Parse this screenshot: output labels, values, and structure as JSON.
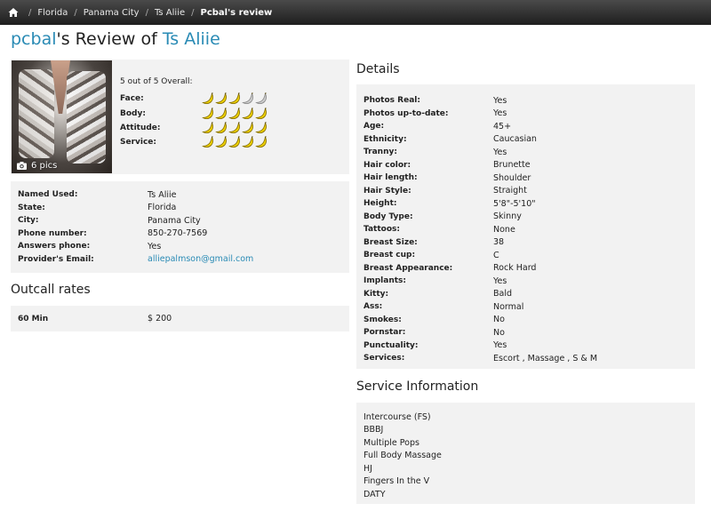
{
  "breadcrumb": {
    "items": [
      {
        "label": "Florida"
      },
      {
        "label": "Panama City"
      },
      {
        "label": "Ts Aliie"
      },
      {
        "label": "Pcbal's review"
      }
    ]
  },
  "title": {
    "user": "pcbal",
    "middle": "'s Review of ",
    "provider": "Ts Aliie"
  },
  "summary": {
    "pics_label": "6 pics",
    "overall": "5 out of 5 Overall:",
    "ratings": [
      {
        "label": "Face:",
        "score": 3,
        "max": 5
      },
      {
        "label": "Body:",
        "score": 5,
        "max": 5
      },
      {
        "label": "Attitude:",
        "score": 5,
        "max": 5
      },
      {
        "label": "Service:",
        "score": 5,
        "max": 5
      }
    ]
  },
  "info": {
    "rows": [
      {
        "k": "Named Used:",
        "v": "Ts Aliie"
      },
      {
        "k": "State:",
        "v": "Florida"
      },
      {
        "k": "City:",
        "v": "Panama City"
      },
      {
        "k": "Phone number:",
        "v": "850-270-7569"
      },
      {
        "k": "Answers phone:",
        "v": "Yes"
      },
      {
        "k": "Provider's Email:",
        "v": "alliepalmson@gmail.com"
      }
    ]
  },
  "outcall": {
    "title": "Outcall rates",
    "rows": [
      {
        "k": "60 Min",
        "v": "$ 200"
      }
    ]
  },
  "details": {
    "title": "Details",
    "rows": [
      {
        "k": "Photos Real:",
        "v": "Yes"
      },
      {
        "k": "Photos up-to-date:",
        "v": "Yes"
      },
      {
        "k": "Age:",
        "v": "45+"
      },
      {
        "k": "Ethnicity:",
        "v": "Caucasian"
      },
      {
        "k": "Tranny:",
        "v": "Yes"
      },
      {
        "k": "Hair color:",
        "v": "Brunette"
      },
      {
        "k": "Hair length:",
        "v": "Shoulder"
      },
      {
        "k": "Hair Style:",
        "v": "Straight"
      },
      {
        "k": "Height:",
        "v": "5'8\"-5'10\""
      },
      {
        "k": "Body Type:",
        "v": "Skinny"
      },
      {
        "k": "Tattoos:",
        "v": "None"
      },
      {
        "k": "Breast Size:",
        "v": "38"
      },
      {
        "k": "Breast cup:",
        "v": "C"
      },
      {
        "k": "Breast Appearance:",
        "v": "Rock Hard"
      },
      {
        "k": "Implants:",
        "v": "Yes"
      },
      {
        "k": "Kitty:",
        "v": "Bald"
      },
      {
        "k": "Ass:",
        "v": "Normal"
      },
      {
        "k": "Smokes:",
        "v": "No"
      },
      {
        "k": "Pornstar:",
        "v": "No"
      },
      {
        "k": "Punctuality:",
        "v": "Yes"
      },
      {
        "k": "Services:",
        "v": "Escort , Massage , S & M"
      }
    ]
  },
  "service_info": {
    "title": "Service Information",
    "items": [
      "Intercourse (FS)",
      "BBBJ",
      "Multiple Pops",
      "Full Body Massage",
      "HJ",
      "Fingers In the V",
      "DATY"
    ]
  },
  "colors": {
    "link": "#2a8bb5",
    "banana_on": "#f2d400",
    "banana_off": "#d0d0d0"
  }
}
